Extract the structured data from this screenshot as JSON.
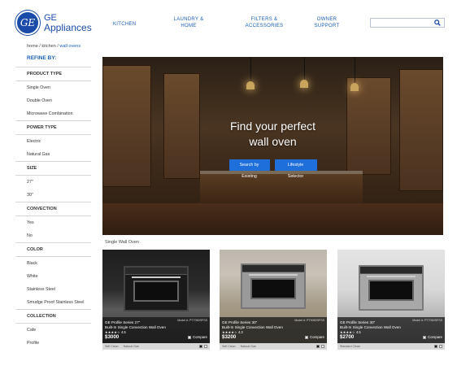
{
  "logo": {
    "mark": "GE",
    "line1": "GE",
    "line2": "Appliances"
  },
  "nav": {
    "kitchen": "KITCHEN",
    "laundry": "LAUNDRY & HOME",
    "filters": "FILTERS & ACCESSORIES",
    "owner": "OWNER SUPPORT"
  },
  "search": {
    "placeholder": "",
    "icon": "search-icon"
  },
  "breadcrumb": {
    "home": "home",
    "sep": " / ",
    "kitchen": "kitchen",
    "current": "wall ovens"
  },
  "sidebar": {
    "refine": "REFINE BY:",
    "groups": [
      {
        "title": "PRODUCT TYPE",
        "options": [
          "Single Oven",
          "Double Oven",
          "Microwave Combination"
        ]
      },
      {
        "title": "POWER TYPE",
        "options": [
          "Electric",
          "Natural Gas"
        ]
      },
      {
        "title": "SIZE",
        "options": [
          "27\"",
          "30\""
        ]
      },
      {
        "title": "CONVECTION",
        "options": [
          "Yes",
          "No"
        ]
      },
      {
        "title": "COLOR",
        "options": [
          "Black",
          "White",
          "Stainless Steel",
          "Smudge Proof Stainless Steel"
        ]
      },
      {
        "title": "COLLECTION",
        "options": [
          "Cafe",
          "Profile"
        ]
      }
    ]
  },
  "hero": {
    "title_line1": "Find your perfect",
    "title_line2": "wall oven",
    "btn_existing": "Search by Existing",
    "btn_lifestyle": "Lifestyle Selector"
  },
  "section": {
    "label": "Single Wall Oven"
  },
  "products": [
    {
      "model": "Model #: PT7050SFSS",
      "line1": "GE Profile Series 27\"",
      "line2": "Built-In Single Convection Wall Oven",
      "rating": "4.5",
      "price": "$3000",
      "compare": "Compare",
      "feat1": "Self Clean",
      "feat2": "Natural Gas"
    },
    {
      "model": "Model #: PT9050SFSS",
      "line1": "GE Profile Series 30\"",
      "line2": "Built-In Single Convection Wall Oven",
      "rating": "4.3",
      "price": "$3200",
      "compare": "Compare",
      "feat1": "Self Clean",
      "feat2": "Natural Gas"
    },
    {
      "model": "Model #: PT7050SFSS",
      "line1": "GE Profile Series 30\"",
      "line2": "Built-In Single Convection Wall Oven",
      "rating": "4.5",
      "price": "$2700",
      "compare": "Compare",
      "feat1": "Standard Clean",
      "feat2": ""
    }
  ],
  "colors": {
    "brand": "#1a4ba8",
    "link": "#1a5fb4",
    "button": "#1e6fd9"
  }
}
